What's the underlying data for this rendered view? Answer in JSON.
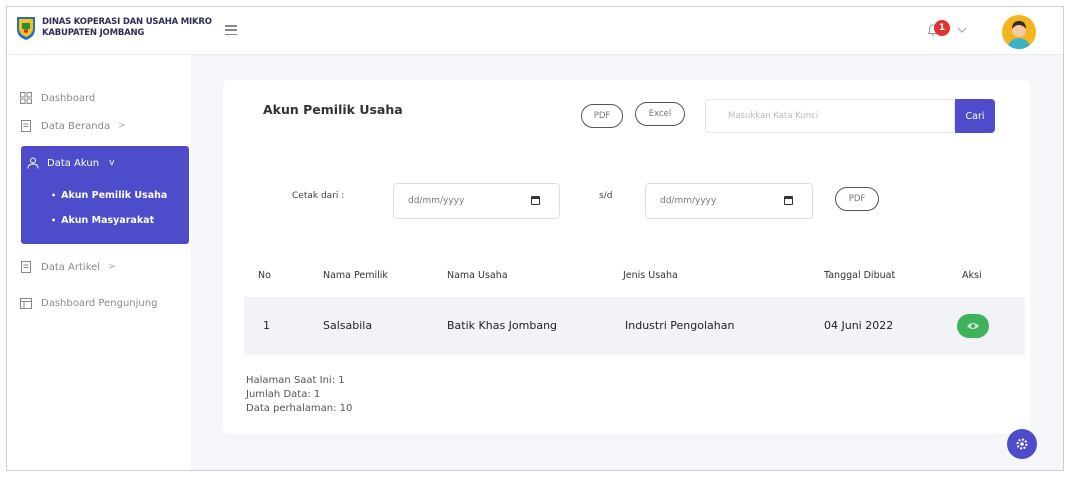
{
  "brand": {
    "line1": "DINAS KOPERASI DAN USAHA MIKRO",
    "line2": "KABUPATEN JOMBANG"
  },
  "header": {
    "notification_count": "1"
  },
  "sidebar": {
    "items": [
      {
        "label": "Dashboard",
        "icon": "dashboard-icon"
      },
      {
        "label": "Data Beranda",
        "icon": "document-icon",
        "caret": ">"
      },
      {
        "label": "Data Akun",
        "icon": "user-icon",
        "caret": "v",
        "active": true,
        "children": [
          {
            "label": "Akun Pemilik Usaha"
          },
          {
            "label": "Akun Masyarakat"
          }
        ]
      },
      {
        "label": "Data Artikel",
        "icon": "document-icon",
        "caret": ">"
      },
      {
        "label": "Dashboard Pengunjung",
        "icon": "calendar-icon"
      }
    ]
  },
  "main": {
    "title": "Akun Pemilik Usaha",
    "pdf_label": "PDF",
    "excel_label": "Excel",
    "search_placeholder": "Masukkan Kata Kunci",
    "search_button": "Cari",
    "print_from_label": "Cetak dari :",
    "date_from_placeholder": "dd/mm/yyyy",
    "range_separator": "s/d",
    "date_to_placeholder": "dd/mm/yyyy",
    "pdf_range_label": "PDF",
    "table": {
      "headers": [
        "No",
        "Nama Pemilik",
        "Nama Usaha",
        "Jenis Usaha",
        "Tanggal Dibuat",
        "Aksi"
      ],
      "rows": [
        [
          "1",
          "Salsabila",
          "Batik Khas Jombang",
          "Industri Pengolahan",
          "04 Juni 2022"
        ]
      ]
    },
    "info": {
      "current_page": "Halaman Saat Ini: 1",
      "total": "Jumlah Data: 1",
      "per_page": "Data perhalaman: 10"
    }
  },
  "colors": {
    "accent": "#4d4dcc",
    "action_green": "#3fb35a",
    "badge_red": "#e0332f"
  }
}
